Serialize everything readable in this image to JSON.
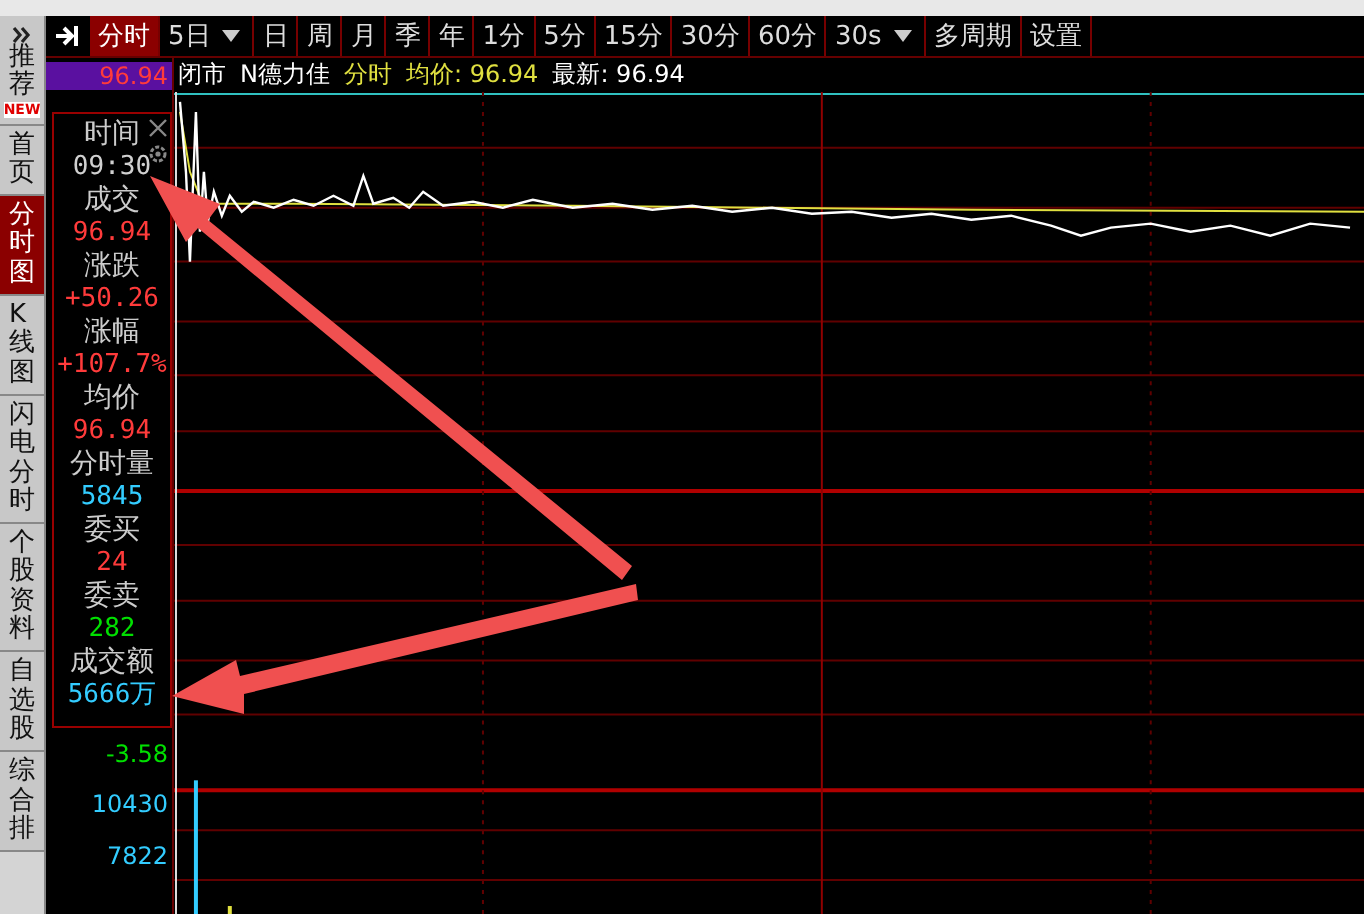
{
  "sidebar": {
    "items": [
      {
        "label": "推荐",
        "badge": "NEW",
        "selected": false,
        "kind": "expander"
      },
      {
        "label": "首页",
        "selected": false
      },
      {
        "label": "分时图",
        "selected": true
      },
      {
        "label": "K线图",
        "selected": false
      },
      {
        "label": "闪电分时",
        "selected": false
      },
      {
        "label": "个股资料",
        "selected": false
      },
      {
        "label": "自选股",
        "selected": false
      },
      {
        "label": "综合排",
        "selected": false
      }
    ]
  },
  "toolbar": {
    "items": [
      {
        "label": "分时",
        "selected": true,
        "kind": "tab"
      },
      {
        "label": "5日",
        "selected": false,
        "kind": "dropdown"
      },
      {
        "label": "日",
        "selected": false,
        "kind": "tab"
      },
      {
        "label": "周",
        "selected": false,
        "kind": "tab"
      },
      {
        "label": "月",
        "selected": false,
        "kind": "tab"
      },
      {
        "label": "季",
        "selected": false,
        "kind": "tab"
      },
      {
        "label": "年",
        "selected": false,
        "kind": "tab"
      },
      {
        "label": "1分",
        "selected": false,
        "kind": "tab"
      },
      {
        "label": "5分",
        "selected": false,
        "kind": "tab"
      },
      {
        "label": "15分",
        "selected": false,
        "kind": "tab"
      },
      {
        "label": "30分",
        "selected": false,
        "kind": "tab"
      },
      {
        "label": "60分",
        "selected": false,
        "kind": "tab"
      },
      {
        "label": "30s",
        "selected": false,
        "kind": "dropdown"
      },
      {
        "label": "多周期",
        "selected": false,
        "kind": "tab"
      },
      {
        "label": "设置",
        "selected": false,
        "kind": "tab"
      }
    ]
  },
  "chart_header": {
    "status": "闭市",
    "stock": "N德力佳",
    "mode": "分时",
    "avg_label": "均价: 96.94",
    "latest_label": "最新: 96.94"
  },
  "axis_labels": [
    {
      "text": "96.94",
      "kind": "current"
    },
    {
      "text": "-3.58",
      "kind": "change"
    },
    {
      "text": "10430",
      "kind": "volume"
    },
    {
      "text": "7822",
      "kind": "volume"
    }
  ],
  "info_panel": {
    "items": [
      {
        "label": "时间",
        "value": "09:30",
        "color": "#d0d0d0"
      },
      {
        "label": "成交",
        "value": "96.94",
        "color": "#ff3b3b"
      },
      {
        "label": "涨跌",
        "value": "+50.26",
        "color": "#ff3b3b"
      },
      {
        "label": "涨幅",
        "value": "+107.7%",
        "color": "#ff3b3b"
      },
      {
        "label": "均价",
        "value": "96.94",
        "color": "#ff3b3b"
      },
      {
        "label": "分时量",
        "value": "5845",
        "color": "#33ccff"
      },
      {
        "label": "委买",
        "value": "24",
        "color": "#ff3b3b"
      },
      {
        "label": "委卖",
        "value": "282",
        "color": "#00e000"
      },
      {
        "label": "成交额",
        "value": "5666万",
        "color": "#33ccff"
      }
    ]
  }
}
